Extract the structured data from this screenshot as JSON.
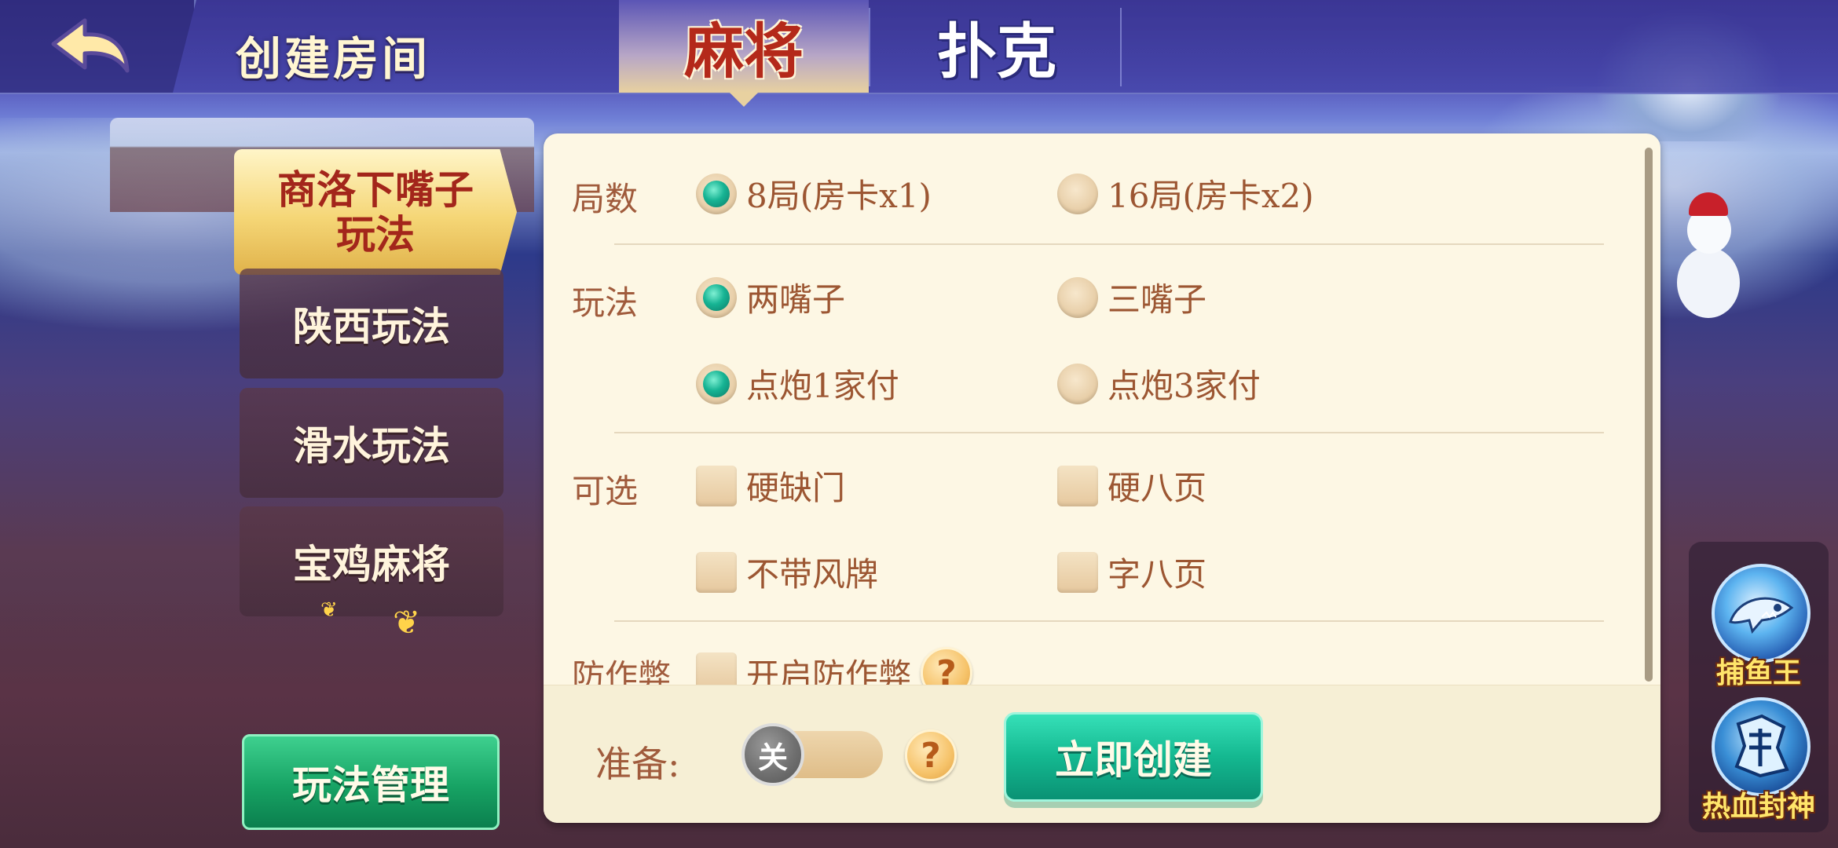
{
  "header": {
    "title": "创建房间",
    "tabs": [
      {
        "label": "麻将",
        "active": true
      },
      {
        "label": "扑克",
        "active": false
      }
    ]
  },
  "sidebar": {
    "items": [
      {
        "label": "商洛下嘴子玩法",
        "active": true
      },
      {
        "label": "陕西玩法",
        "active": false
      },
      {
        "label": "滑水玩法",
        "active": false
      },
      {
        "label": "宝鸡麻将",
        "active": false
      }
    ],
    "manage_label": "玩法管理"
  },
  "options": {
    "rounds": {
      "label": "局数",
      "choices": [
        {
          "label": "8局(房卡x1)",
          "checked": true
        },
        {
          "label": "16局(房卡x2)",
          "checked": false
        }
      ]
    },
    "play": {
      "label": "玩法",
      "choices": [
        {
          "label": "两嘴子",
          "checked": true
        },
        {
          "label": "三嘴子",
          "checked": false
        },
        {
          "label": "点炮1家付",
          "checked": true
        },
        {
          "label": "点炮3家付",
          "checked": false
        }
      ]
    },
    "optional": {
      "label": "可选",
      "choices": [
        {
          "label": "硬缺门",
          "checked": false
        },
        {
          "label": "硬八页",
          "checked": false
        },
        {
          "label": "不带风牌",
          "checked": false
        },
        {
          "label": "字八页",
          "checked": false
        }
      ]
    },
    "anticheat": {
      "label": "防作弊",
      "choices": [
        {
          "label": "开启防作弊",
          "checked": false
        }
      ],
      "help": "?"
    }
  },
  "footer": {
    "ready_label": "准备:",
    "toggle_label": "关",
    "toggle_on": false,
    "help": "?",
    "create_label": "立即创建"
  },
  "games": [
    {
      "label": "捕鱼王",
      "icon": "shark-icon"
    },
    {
      "label": "热血封神",
      "icon": "dragon-icon"
    }
  ],
  "colors": {
    "accent_green": "#14b890",
    "title_red": "#b4291a",
    "option_text": "#9c5632",
    "panel_bg": "#fdf7e4"
  }
}
